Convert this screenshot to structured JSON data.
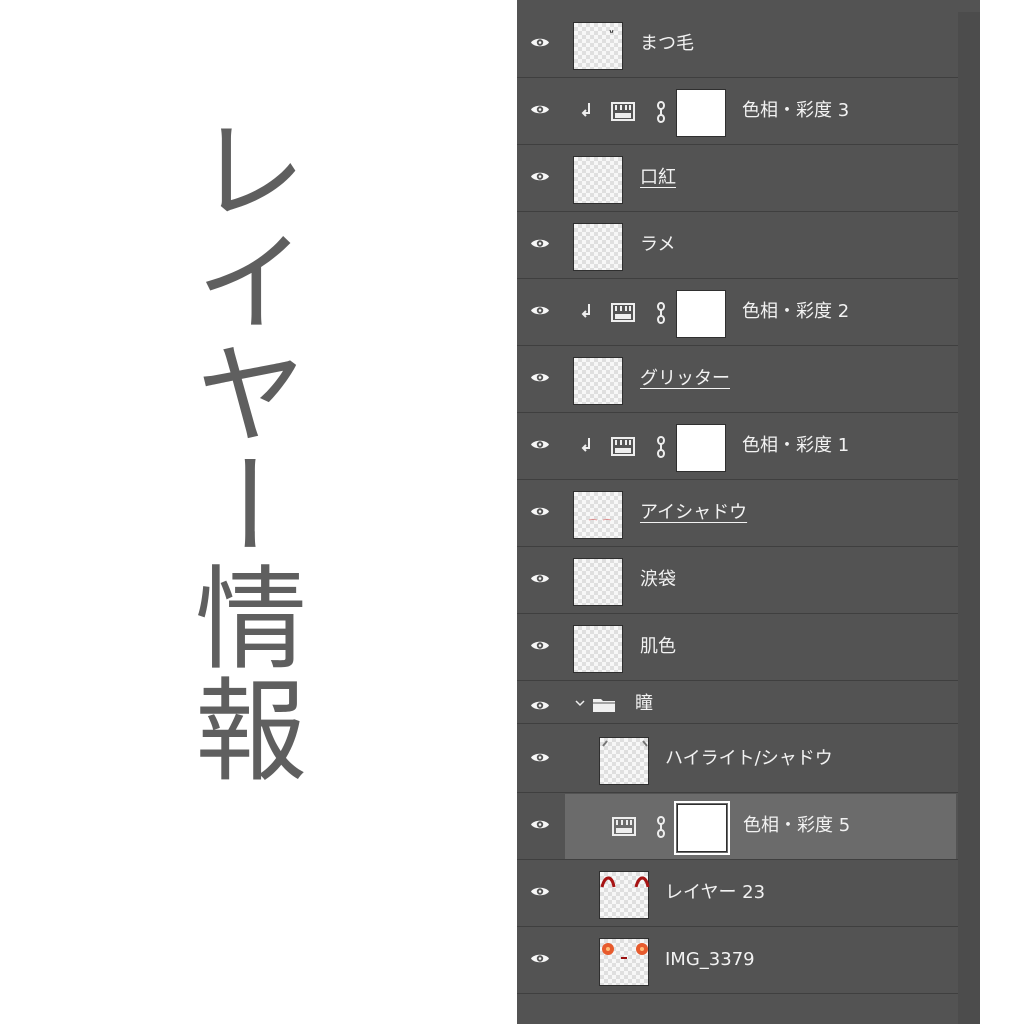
{
  "title": "レイヤー情報",
  "panel": {
    "layers": [
      {
        "name": "まつ毛",
        "type": "pixel"
      },
      {
        "name": "色相・彩度 3",
        "type": "adjustment",
        "clipped": true
      },
      {
        "name": "口紅",
        "type": "pixel"
      },
      {
        "name": "ラメ",
        "type": "pixel"
      },
      {
        "name": "色相・彩度 2",
        "type": "adjustment",
        "clipped": true
      },
      {
        "name": "グリッター",
        "type": "pixel"
      },
      {
        "name": "色相・彩度 1",
        "type": "adjustment",
        "clipped": true
      },
      {
        "name": "アイシャドウ",
        "type": "pixel"
      },
      {
        "name": "涙袋",
        "type": "pixel"
      },
      {
        "name": "肌色",
        "type": "pixel"
      },
      {
        "name": "瞳",
        "type": "group",
        "expanded": true
      },
      {
        "name": "ハイライト/シャドウ",
        "type": "pixel",
        "indent": true
      },
      {
        "name": "色相・彩度 5",
        "type": "adjustment",
        "indent": true,
        "selected": true
      },
      {
        "name": "レイヤー 23",
        "type": "pixel",
        "indent": true
      },
      {
        "name": "IMG_3379",
        "type": "pixel",
        "indent": true
      }
    ]
  },
  "colors": {
    "panel_bg": "#535353",
    "selected_bg": "#6b6b6b",
    "text": "#f2f2f2",
    "title": "#5f5f5f"
  },
  "icons": {
    "eye": "eye-icon",
    "clip": "clipping-arrow-icon",
    "adjustment": "hue-saturation-icon",
    "link": "chain-link-icon",
    "folder": "folder-icon"
  }
}
